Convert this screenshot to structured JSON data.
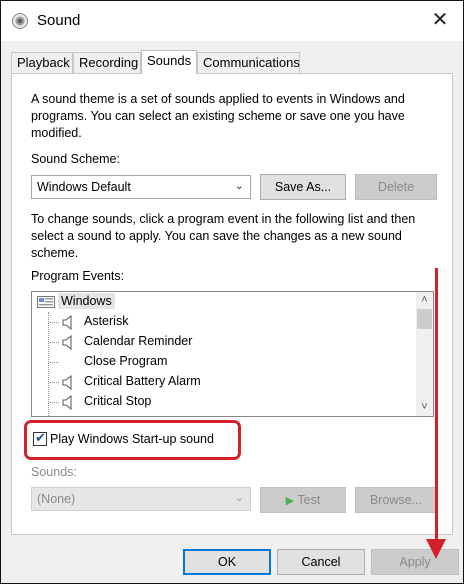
{
  "window": {
    "title": "Sound",
    "icon": "speaker-icon",
    "close_glyph": "✕"
  },
  "tabs": [
    {
      "label": "Playback",
      "active": false
    },
    {
      "label": "Recording",
      "active": false
    },
    {
      "label": "Sounds",
      "active": true
    },
    {
      "label": "Communications",
      "active": false
    }
  ],
  "sounds": {
    "intro_text": "A sound theme is a set of sounds applied to events in Windows and programs.  You can select an existing scheme or save one you have modified.",
    "scheme_label": "Sound Scheme:",
    "scheme_value": "Windows Default",
    "save_as_label": "Save As...",
    "delete_label": "Delete",
    "change_text": "To change sounds, click a program event in the following list and then select a sound to apply.  You can save the changes as a new sound scheme.",
    "program_events_label": "Program Events:",
    "events": [
      {
        "label": "Windows",
        "has_sound": false,
        "is_group": true
      },
      {
        "label": "Asterisk",
        "has_sound": true
      },
      {
        "label": "Calendar Reminder",
        "has_sound": true
      },
      {
        "label": "Close Program",
        "has_sound": false
      },
      {
        "label": "Critical Battery Alarm",
        "has_sound": true
      },
      {
        "label": "Critical Stop",
        "has_sound": true
      }
    ],
    "startup_checkbox_label": "Play Windows Start-up sound",
    "startup_checked": true,
    "sounds_label": "Sounds:",
    "sounds_value": "(None)",
    "test_label": "Test",
    "browse_label": "Browse..."
  },
  "footer": {
    "ok_label": "OK",
    "cancel_label": "Cancel",
    "apply_label": "Apply"
  },
  "annotation": {
    "color": "#d3212c"
  }
}
